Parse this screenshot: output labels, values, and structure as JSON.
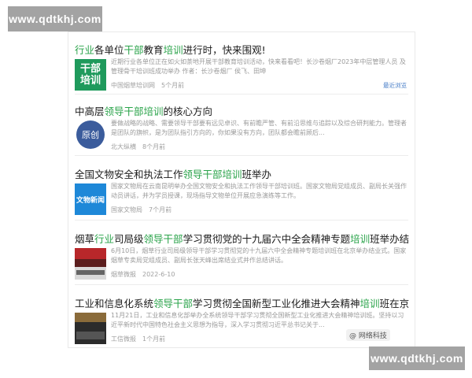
{
  "watermark": {
    "top": "www.qdtkhj.com",
    "bottom": "www.qdtkhj.com"
  },
  "articles": [
    {
      "title_pre": "",
      "title_hl1": "行业",
      "title_mid1": "各单位",
      "title_hl2": "干部",
      "title_mid2": "教育",
      "title_hl3": "培训",
      "title_post": "进行时，快来围观!",
      "thumb_text": "干部\n培训",
      "summary": "近期行业各单位正在如火如荼地开展干部教育培训活动，快来看看吧！长沙卷烟厂2023年中层管理人员 及管理骨干培训班成功举办 作者：长沙卷烟厂 侯飞、田坤",
      "source": "中国烟草培训网",
      "time": "5个月前",
      "extra": "最近浏览"
    },
    {
      "title_pre": "中高层",
      "title_hl1": "领导干部培训",
      "title_mid1": "的核心方向",
      "title_hl2": "",
      "title_mid2": "",
      "title_hl3": "",
      "title_post": "",
      "thumb_text": "原创",
      "summary": "要做战略的战略、需要领导干部要有远见卓识、有前瞻严管、有前沿思维与追踪以及综合研判能力。管理者是团队的旗帜，是为团队指引方向的，你如果没有方向，团队都会瞻前顾后...",
      "source": "北大纵横",
      "time": "8个月前"
    },
    {
      "title_pre": "全国文物安全和执法工作",
      "title_hl1": "领导干部培训",
      "title_mid1": "班举办",
      "title_hl2": "",
      "title_mid2": "",
      "title_hl3": "",
      "title_post": "",
      "thumb_text": "文物新闻",
      "summary": "国家文物局在云南昆明举办全国文物安全和执法工作领导干部培训班。国家文物局党组成员、副局长关强作动员讲话，并为学员授课，现场指导文物单位开展应急演练等工作。",
      "source": "国家文物局",
      "time": "7个月前"
    },
    {
      "title_pre": "烟草",
      "title_hl1": "行业",
      "title_mid1": "司局级",
      "title_hl2": "领导干部",
      "title_mid2": "学习贯彻党的十九届六中全会精神专题",
      "title_hl3": "培训",
      "title_post": "班举办结业式",
      "thumb_text": "",
      "summary": "6月10日，烟草行业司局级领导干部学习贯彻党的十九届六中全会精神专题培训班在北京举办结业式。国家烟草专卖局党组成员、副局长张天峰出席结业式并作总结讲话。",
      "source": "烟草微报",
      "time": "2022-6-10"
    },
    {
      "title_pre": "工业和信息化系统",
      "title_hl1": "领导干部",
      "title_mid1": "学习贯彻全国新型工业化推进大会精神",
      "title_hl2": "培训",
      "title_mid2": "班在京举办",
      "title_hl3": "",
      "title_post": "",
      "thumb_text": "",
      "summary": "11月21日，工业和信息化部举办全系统领导干部学习贯彻全国新型工业化推进大会精神培训班。坚持以习近平新时代中国特色社会主义思想为指导，深入学习贯彻习近平总书记关于...",
      "source": "工信微报",
      "time": "1个月前"
    }
  ],
  "source_tag": "@ 网络科技",
  "colors": {
    "highlight": "#2aa34a",
    "accent_link": "#4a7fc8"
  }
}
